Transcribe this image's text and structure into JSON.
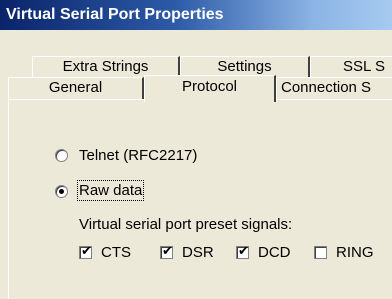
{
  "window": {
    "title": "Virtual Serial Port Properties"
  },
  "tabs": {
    "row1": [
      "Extra Strings",
      "Settings",
      "SSL S"
    ],
    "row2": [
      "General",
      "Protocol",
      "Connection S"
    ],
    "active": "Protocol"
  },
  "protocol": {
    "options": [
      {
        "label": "Telnet (RFC2217)",
        "selected": false
      },
      {
        "label": "Raw data",
        "selected": true
      }
    ],
    "preset_label": "Virtual serial port preset signals:",
    "signals": [
      {
        "label": "CTS",
        "checked": true
      },
      {
        "label": "DSR",
        "checked": true
      },
      {
        "label": "DCD",
        "checked": true
      },
      {
        "label": "RING",
        "checked": false
      }
    ]
  },
  "glyphs": {
    "check": "✔"
  }
}
